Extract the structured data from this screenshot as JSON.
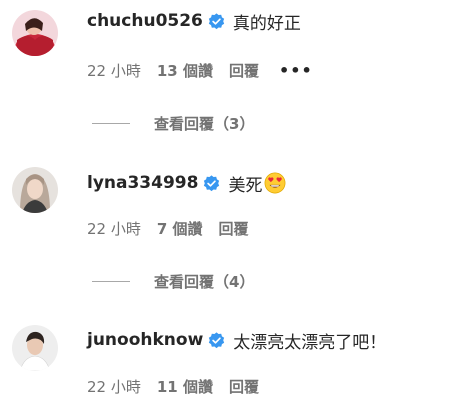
{
  "comments": [
    {
      "username": "chuchu0526",
      "text": "真的好正",
      "timestamp": "22 小時",
      "likes": "13 個讚",
      "reply_label": "回覆",
      "more_label": "•••",
      "view_replies_label": "查看回覆（3）",
      "verified": true,
      "emoji": ""
    },
    {
      "username": "lyna334998",
      "text": "美死",
      "timestamp": "22 小時",
      "likes": "7 個讚",
      "reply_label": "回覆",
      "view_replies_label": "查看回覆（4）",
      "verified": true,
      "emoji": "heart-eyes-emoji"
    },
    {
      "username": "junoohknow",
      "text": "太漂亮太漂亮了吧！",
      "timestamp": "22 小時",
      "likes": "11 個讚",
      "reply_label": "回覆",
      "verified": true,
      "emoji": ""
    }
  ],
  "colors": {
    "verified_badge": "#3897f0",
    "muted_text": "#737373",
    "primary_text": "#262626"
  }
}
